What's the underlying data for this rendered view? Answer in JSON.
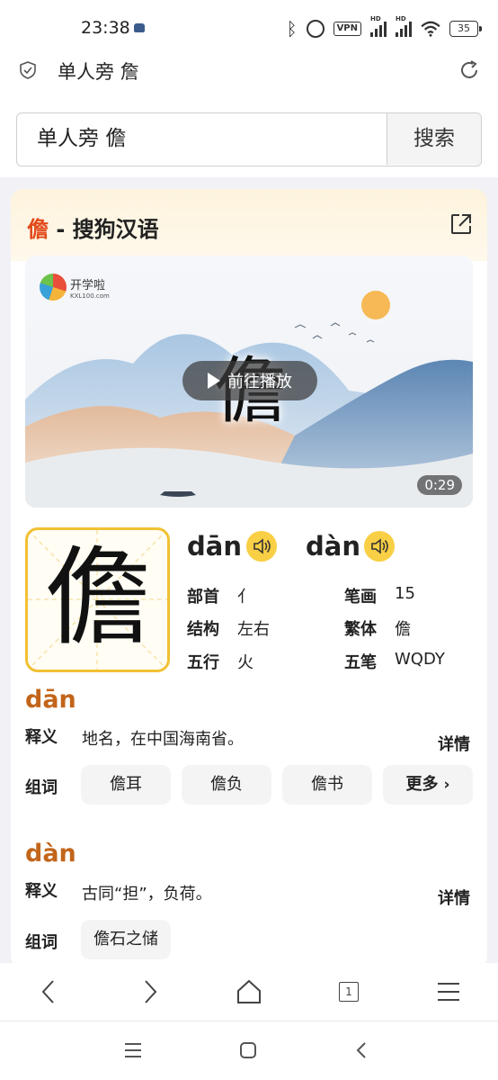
{
  "status": {
    "time": "23:38",
    "vpn": "VPN",
    "hd1": "HD",
    "hd2": "HD",
    "battery": "35"
  },
  "browser": {
    "tab_title": "单人旁 詹"
  },
  "search": {
    "query": "单人旁 儋",
    "button": "搜索"
  },
  "card": {
    "title_char": "儋",
    "title_rest": " - 搜狗汉语",
    "video": {
      "logo_name": "开学啦",
      "logo_domain": "KXL100.com",
      "character": "儋",
      "play_label": "前往播放",
      "duration": "0:29"
    },
    "glyph": "儋",
    "pinyins": [
      {
        "py": "dān"
      },
      {
        "py": "dàn"
      }
    ],
    "info": {
      "radical_label": "部首",
      "radical": "亻",
      "strokes_label": "笔画",
      "strokes": "15",
      "structure_label": "结构",
      "structure": "左右",
      "traditional_label": "繁体",
      "traditional": "儋",
      "wuxing_label": "五行",
      "wuxing": "火",
      "wubi_label": "五笔",
      "wubi": "WQDY"
    },
    "sections": [
      {
        "pinyin": "dān",
        "meaning_label": "释义",
        "meaning": "地名，在中国海南省。",
        "detail": "详情",
        "words_label": "组词",
        "words": [
          "儋耳",
          "儋负",
          "儋书"
        ],
        "more": "更多"
      },
      {
        "pinyin": "dàn",
        "meaning_label": "释义",
        "meaning": "古同“担”，负荷。",
        "detail": "详情",
        "words_label": "组词",
        "words": [
          "儋石之储"
        ]
      }
    ]
  },
  "nav": {
    "tabs_count": "1"
  }
}
